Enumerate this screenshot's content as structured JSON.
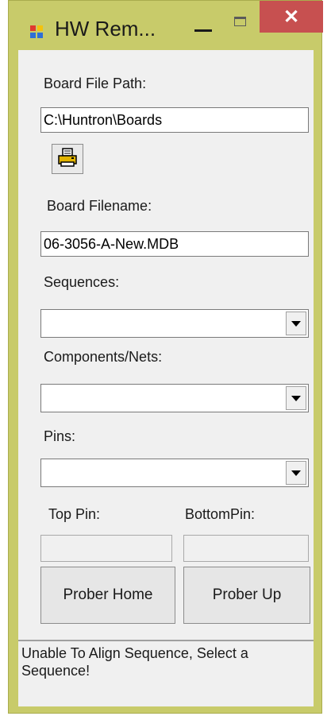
{
  "window": {
    "title": "HW Rem...",
    "close_symbol": "✕"
  },
  "board_file_path": {
    "label": "Board File Path:",
    "value": "C:\\Huntron\\Boards",
    "browse_icon": "printer-icon"
  },
  "board_filename": {
    "label": "Board Filename:",
    "value": "06-3056-A-New.MDB"
  },
  "sequences": {
    "label": "Sequences:",
    "selected": ""
  },
  "components_nets": {
    "label": "Components/Nets:",
    "selected": ""
  },
  "pins": {
    "label": "Pins:",
    "selected": ""
  },
  "top_pin": {
    "label": "Top Pin:",
    "value": ""
  },
  "bottom_pin": {
    "label": "BottomPin:",
    "value": ""
  },
  "buttons": {
    "prober_home": "Prober Home",
    "prober_up": "Prober Up"
  },
  "status": {
    "message": "Unable To Align Sequence, Select a Sequence!"
  },
  "colors": {
    "frame": "#c8cb6a",
    "close_button": "#c75050",
    "client_background": "#f0f0f0"
  }
}
